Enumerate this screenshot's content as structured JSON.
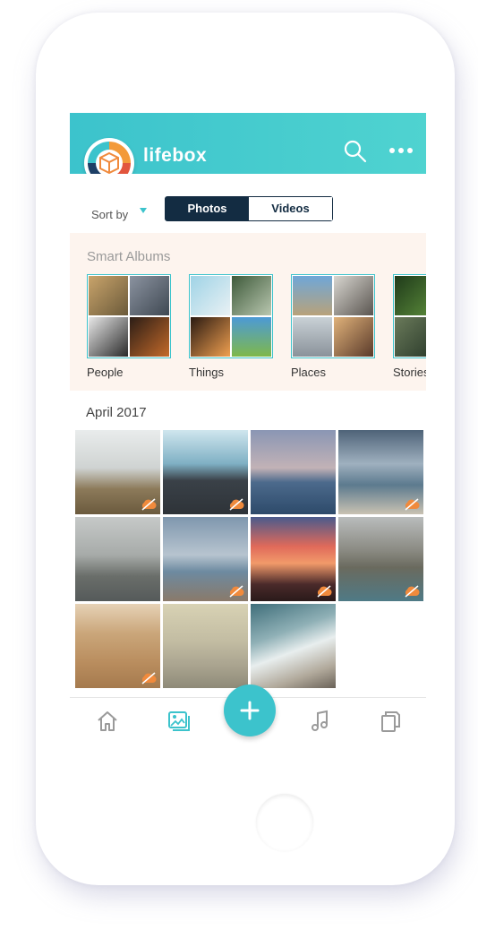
{
  "app": {
    "name": "lifebox"
  },
  "header": {
    "search_icon": "search-icon",
    "more_icon": "more-dots-icon"
  },
  "sort": {
    "label": "Sort by"
  },
  "segmented": {
    "photos": "Photos",
    "videos": "Videos",
    "active": "Photos"
  },
  "smart_albums": {
    "title": "Smart Albums",
    "items": [
      {
        "label": "People"
      },
      {
        "label": "Things"
      },
      {
        "label": "Places"
      },
      {
        "label": "Stories"
      }
    ]
  },
  "section": {
    "month": "April 2017"
  },
  "tabbar": {
    "tabs": [
      {
        "icon": "home-icon"
      },
      {
        "icon": "photos-icon",
        "active": true
      },
      {
        "icon": "music-icon"
      },
      {
        "icon": "documents-icon"
      }
    ],
    "fab_icon": "plus-icon"
  },
  "colors": {
    "accent": "#3cc3cc",
    "dark": "#132c42",
    "sync_badge": "#f08a3c"
  }
}
